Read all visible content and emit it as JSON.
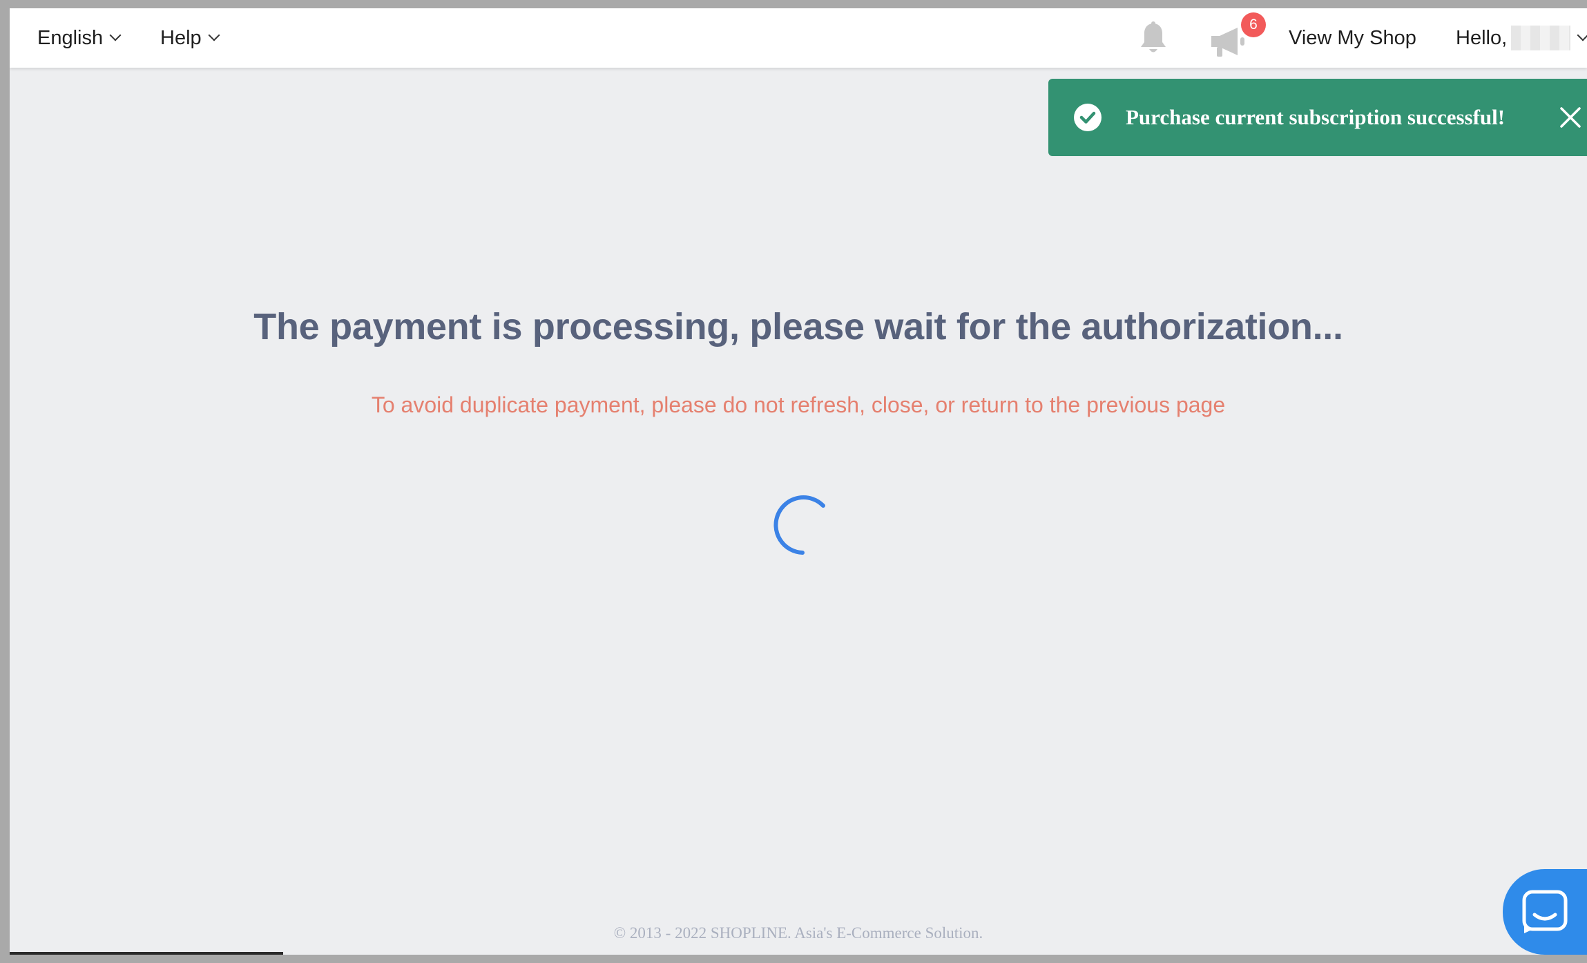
{
  "header": {
    "language_label": "English",
    "help_label": "Help",
    "notification_count": "6",
    "view_shop_label": "View My Shop",
    "greeting": "Hello,"
  },
  "toast": {
    "message": "Purchase current subscription successful!",
    "color": "#339272"
  },
  "main": {
    "headline": "The payment is processing, please wait for the authorization...",
    "warning": "To avoid duplicate payment, please do not refresh, close, or return to the previous page"
  },
  "footer": {
    "copyright": "© 2013 - 2022 SHOPLINE. Asia's E-Commerce Solution."
  },
  "colors": {
    "headline": "#58627c",
    "warning": "#e5806f",
    "spinner": "#3b82e6",
    "badge": "#f25a5a",
    "chat": "#2f8bea"
  },
  "icons": [
    "chevron-down-icon",
    "bell-icon",
    "megaphone-icon",
    "check-circle-icon",
    "close-icon",
    "spinner-icon",
    "chat-icon"
  ]
}
